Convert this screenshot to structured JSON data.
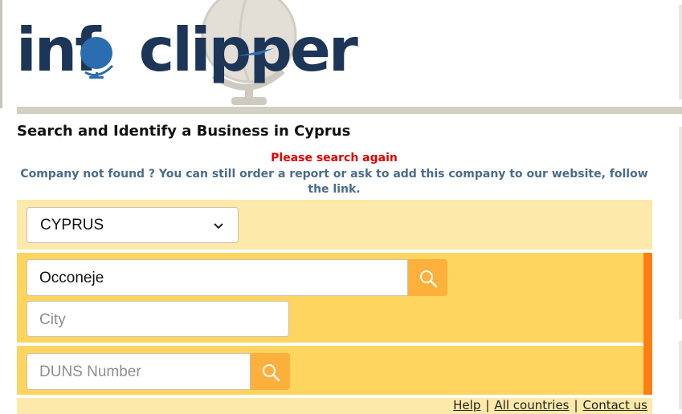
{
  "brand": {
    "logo_text": "infoclipper",
    "logo_part1": "inf",
    "logo_part2": "clipper"
  },
  "page": {
    "title": "Search and Identify a Business in Cyprus"
  },
  "messages": {
    "error": "Please search again",
    "info": "Company not found ? You can still order a report or ask to add this company to our website, follow the link."
  },
  "search": {
    "country_value": "CYPRUS",
    "company_value": "Occoneje",
    "city_placeholder": "City",
    "duns_placeholder": "DUNS Number"
  },
  "footer": {
    "links": [
      "Help",
      "All countries",
      "Contact us"
    ],
    "separator": "|"
  },
  "colors": {
    "panel_light": "#fde9a9",
    "panel_main": "#fed55f",
    "accent_orange": "#fd7f13",
    "button": "#fdb03b",
    "error": "#e00000",
    "info": "#4b6b8a",
    "logo_dark": "#1d3557",
    "logo_blue": "#2a6db0"
  },
  "icons": {
    "search": "search-icon",
    "chevron": "chevron-down-icon",
    "globe": "globe-icon"
  }
}
